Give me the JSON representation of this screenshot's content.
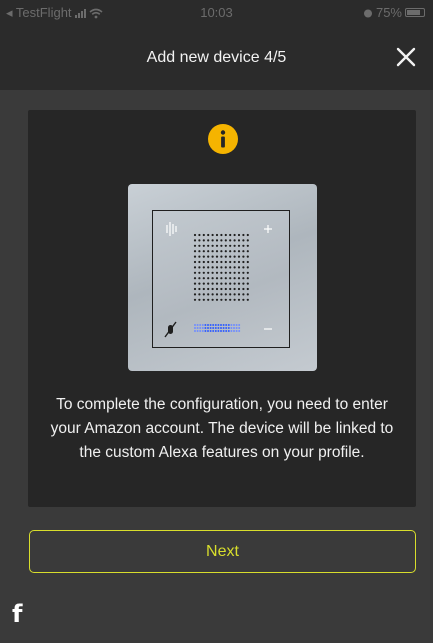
{
  "status_bar": {
    "back_app": "◂ TestFlight",
    "time": "10:03",
    "battery": "75%"
  },
  "header": {
    "title": "Add new device 4/5"
  },
  "card": {
    "description": "To complete the configuration, you need to enter your Amazon account. The device will be linked to the custom Alexa features on your profile."
  },
  "actions": {
    "next_label": "Next"
  },
  "brand": {
    "logo_letter": "f"
  },
  "colors": {
    "accent": "#d8de2c",
    "info": "#f5b400",
    "background": "#3a3a3a",
    "card": "#262626",
    "header": "#2b2b2b",
    "led": "#2f5cff"
  },
  "icons": [
    "signal-icon",
    "wifi-icon",
    "alarm-icon",
    "battery-icon",
    "close-icon",
    "info-icon"
  ]
}
